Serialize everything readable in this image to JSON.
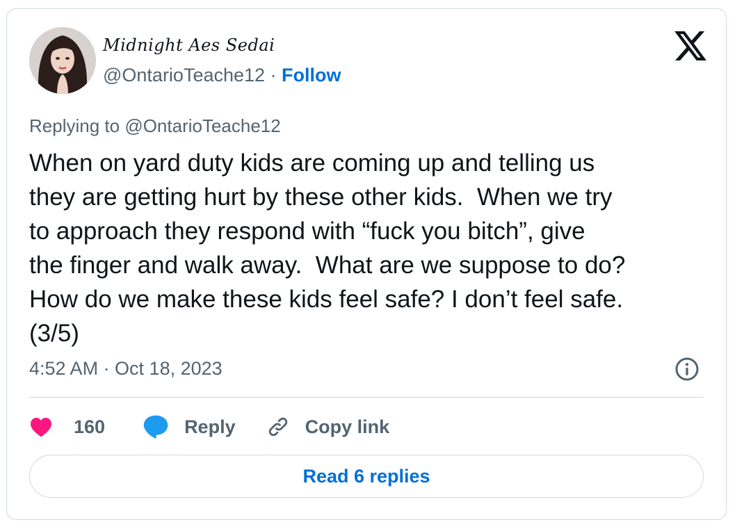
{
  "author": {
    "display_name": "Midnight Aes Sedai",
    "handle": "@OntarioTeache12",
    "separator": " · ",
    "follow_label": "Follow"
  },
  "brand_icon": "x-logo-icon",
  "replying_to": {
    "prefix": "Replying to ",
    "handle": "@OntarioTeache12"
  },
  "tweet": {
    "text": "When on yard duty kids are coming up and telling us\nthey are getting hurt by these other kids.  When we try\nto approach they respond with “fuck you bitch”, give\nthe finger and walk away.  What are we suppose to do?\nHow do we make these kids feel safe? I don’t feel safe.\n(3/5)",
    "timestamp": "4:52 AM · Oct 18, 2023"
  },
  "actions": {
    "like_count": "160",
    "reply_label": "Reply",
    "copy_link_label": "Copy link"
  },
  "footer": {
    "read_replies_label": "Read 6 replies"
  },
  "colors": {
    "accent": "#006fd6",
    "heart": "#f91880",
    "reply_bubble": "#1d9bf0",
    "muted_text": "#536471",
    "border": "#cfd9de"
  }
}
